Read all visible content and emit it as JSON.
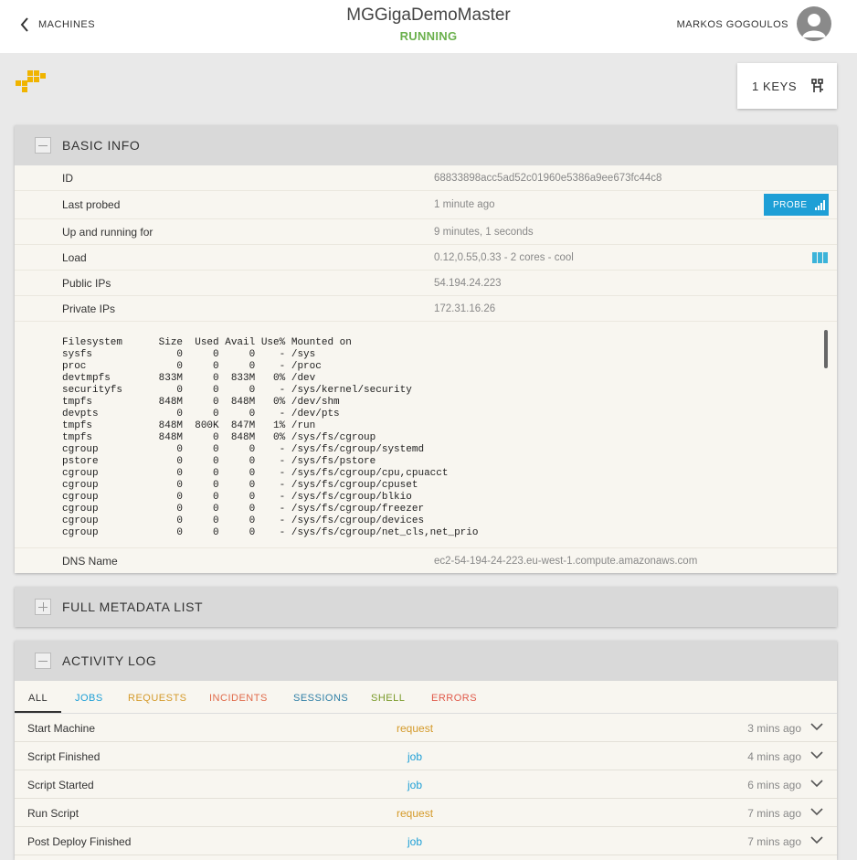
{
  "header": {
    "back_label": "MACHINES",
    "title": "MGGigaDemoMaster",
    "status": "RUNNING",
    "user_name": "MARKOS GOGOULOS"
  },
  "keys_button": {
    "label": "1 KEYS"
  },
  "basic_info": {
    "title": "BASIC INFO",
    "rows": [
      {
        "key": "ID",
        "value": "68833898acc5ad52c01960e5386a9ee673fc44c8"
      },
      {
        "key": "Last probed",
        "value": "1 minute ago"
      },
      {
        "key": "Up and running for",
        "value": "9 minutes, 1 seconds"
      },
      {
        "key": "Load",
        "value": "0.12,0.55,0.33 - 2 cores - cool"
      },
      {
        "key": "Public IPs",
        "value": "54.194.24.223"
      },
      {
        "key": "Private IPs",
        "value": "172.31.16.26"
      }
    ],
    "probe_label": "PROBE",
    "df_lines": [
      "Filesystem      Size  Used Avail Use% Mounted on",
      "sysfs              0     0     0    - /sys",
      "proc               0     0     0    - /proc",
      "devtmpfs        833M     0  833M   0% /dev",
      "securityfs         0     0     0    - /sys/kernel/security",
      "tmpfs           848M     0  848M   0% /dev/shm",
      "devpts             0     0     0    - /dev/pts",
      "tmpfs           848M  800K  847M   1% /run",
      "tmpfs           848M     0  848M   0% /sys/fs/cgroup",
      "cgroup             0     0     0    - /sys/fs/cgroup/systemd",
      "pstore             0     0     0    - /sys/fs/pstore",
      "cgroup             0     0     0    - /sys/fs/cgroup/cpu,cpuacct",
      "cgroup             0     0     0    - /sys/fs/cgroup/cpuset",
      "cgroup             0     0     0    - /sys/fs/cgroup/blkio",
      "cgroup             0     0     0    - /sys/fs/cgroup/freezer",
      "cgroup             0     0     0    - /sys/fs/cgroup/devices",
      "cgroup             0     0     0    - /sys/fs/cgroup/net_cls,net_prio"
    ],
    "dns_key": "DNS Name",
    "dns_value": "ec2-54-194-24-223.eu-west-1.compute.amazonaws.com"
  },
  "metadata": {
    "title": "FULL METADATA LIST"
  },
  "activity": {
    "title": "ACTIVITY LOG",
    "tabs": [
      {
        "label": "ALL",
        "color": "#333333"
      },
      {
        "label": "JOBS",
        "color": "#1e9fd6"
      },
      {
        "label": "REQUESTS",
        "color": "#d49a2a"
      },
      {
        "label": "INCIDENTS",
        "color": "#e06a4a"
      },
      {
        "label": "SESSIONS",
        "color": "#2f7fa6"
      },
      {
        "label": "SHELL",
        "color": "#7a9a2a"
      },
      {
        "label": "ERRORS",
        "color": "#e05a4a"
      }
    ],
    "rows": [
      {
        "name": "Start Machine",
        "type": "request",
        "time": "3 mins ago"
      },
      {
        "name": "Script Finished",
        "type": "job",
        "time": "4 mins ago"
      },
      {
        "name": "Script Started",
        "type": "job",
        "time": "6 mins ago"
      },
      {
        "name": "Run Script",
        "type": "request",
        "time": "7 mins ago"
      },
      {
        "name": "Post Deploy Finished",
        "type": "job",
        "time": "7 mins ago"
      }
    ]
  },
  "colors": {
    "running": "#6ab04c",
    "probe": "#1e9fd6",
    "request": "#d49a2a",
    "job": "#1e9fd6"
  }
}
